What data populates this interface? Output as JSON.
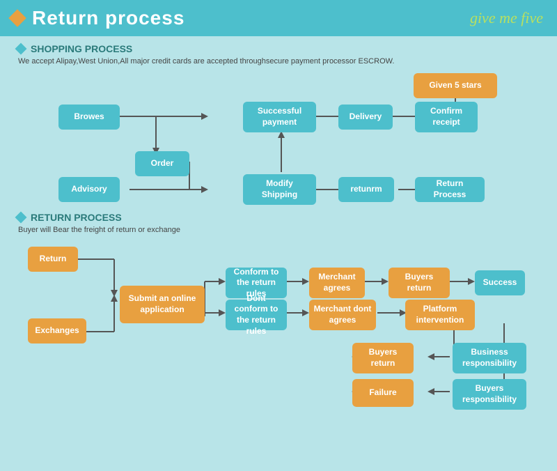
{
  "header": {
    "title": "Return process",
    "logo": "give me five"
  },
  "shopping": {
    "section_title": "SHOPPING PROCESS",
    "subtitle": "We accept Alipay,West Union,All major credit cards are accepted throughsecure payment processor ESCROW.",
    "boxes": {
      "browes": "Browes",
      "order": "Order",
      "advisory": "Advisory",
      "modify_shipping": "Modify Shipping",
      "successful_payment": "Successful payment",
      "delivery": "Delivery",
      "confirm_receipt": "Confirm receipt",
      "given_5_stars": "Given 5 stars",
      "returnm": "retunrm",
      "return_process": "Return Process"
    }
  },
  "return": {
    "section_title": "RETURN PROCESS",
    "subtitle": "Buyer will Bear the freight of return or exchange",
    "boxes": {
      "return": "Return",
      "exchanges": "Exchanges",
      "submit_online": "Submit an online application",
      "conform_rules": "Conform to the return rules",
      "dont_conform": "Dont conform to the return rules",
      "merchant_agrees": "Merchant agrees",
      "merchant_dont": "Merchant dont agrees",
      "buyers_return_1": "Buyers return",
      "buyers_return_2": "Buyers return",
      "success": "Success",
      "platform_intervention": "Platform intervention",
      "business_responsibility": "Business responsibility",
      "buyers_responsibility": "Buyers responsibility",
      "failure": "Failure"
    }
  }
}
